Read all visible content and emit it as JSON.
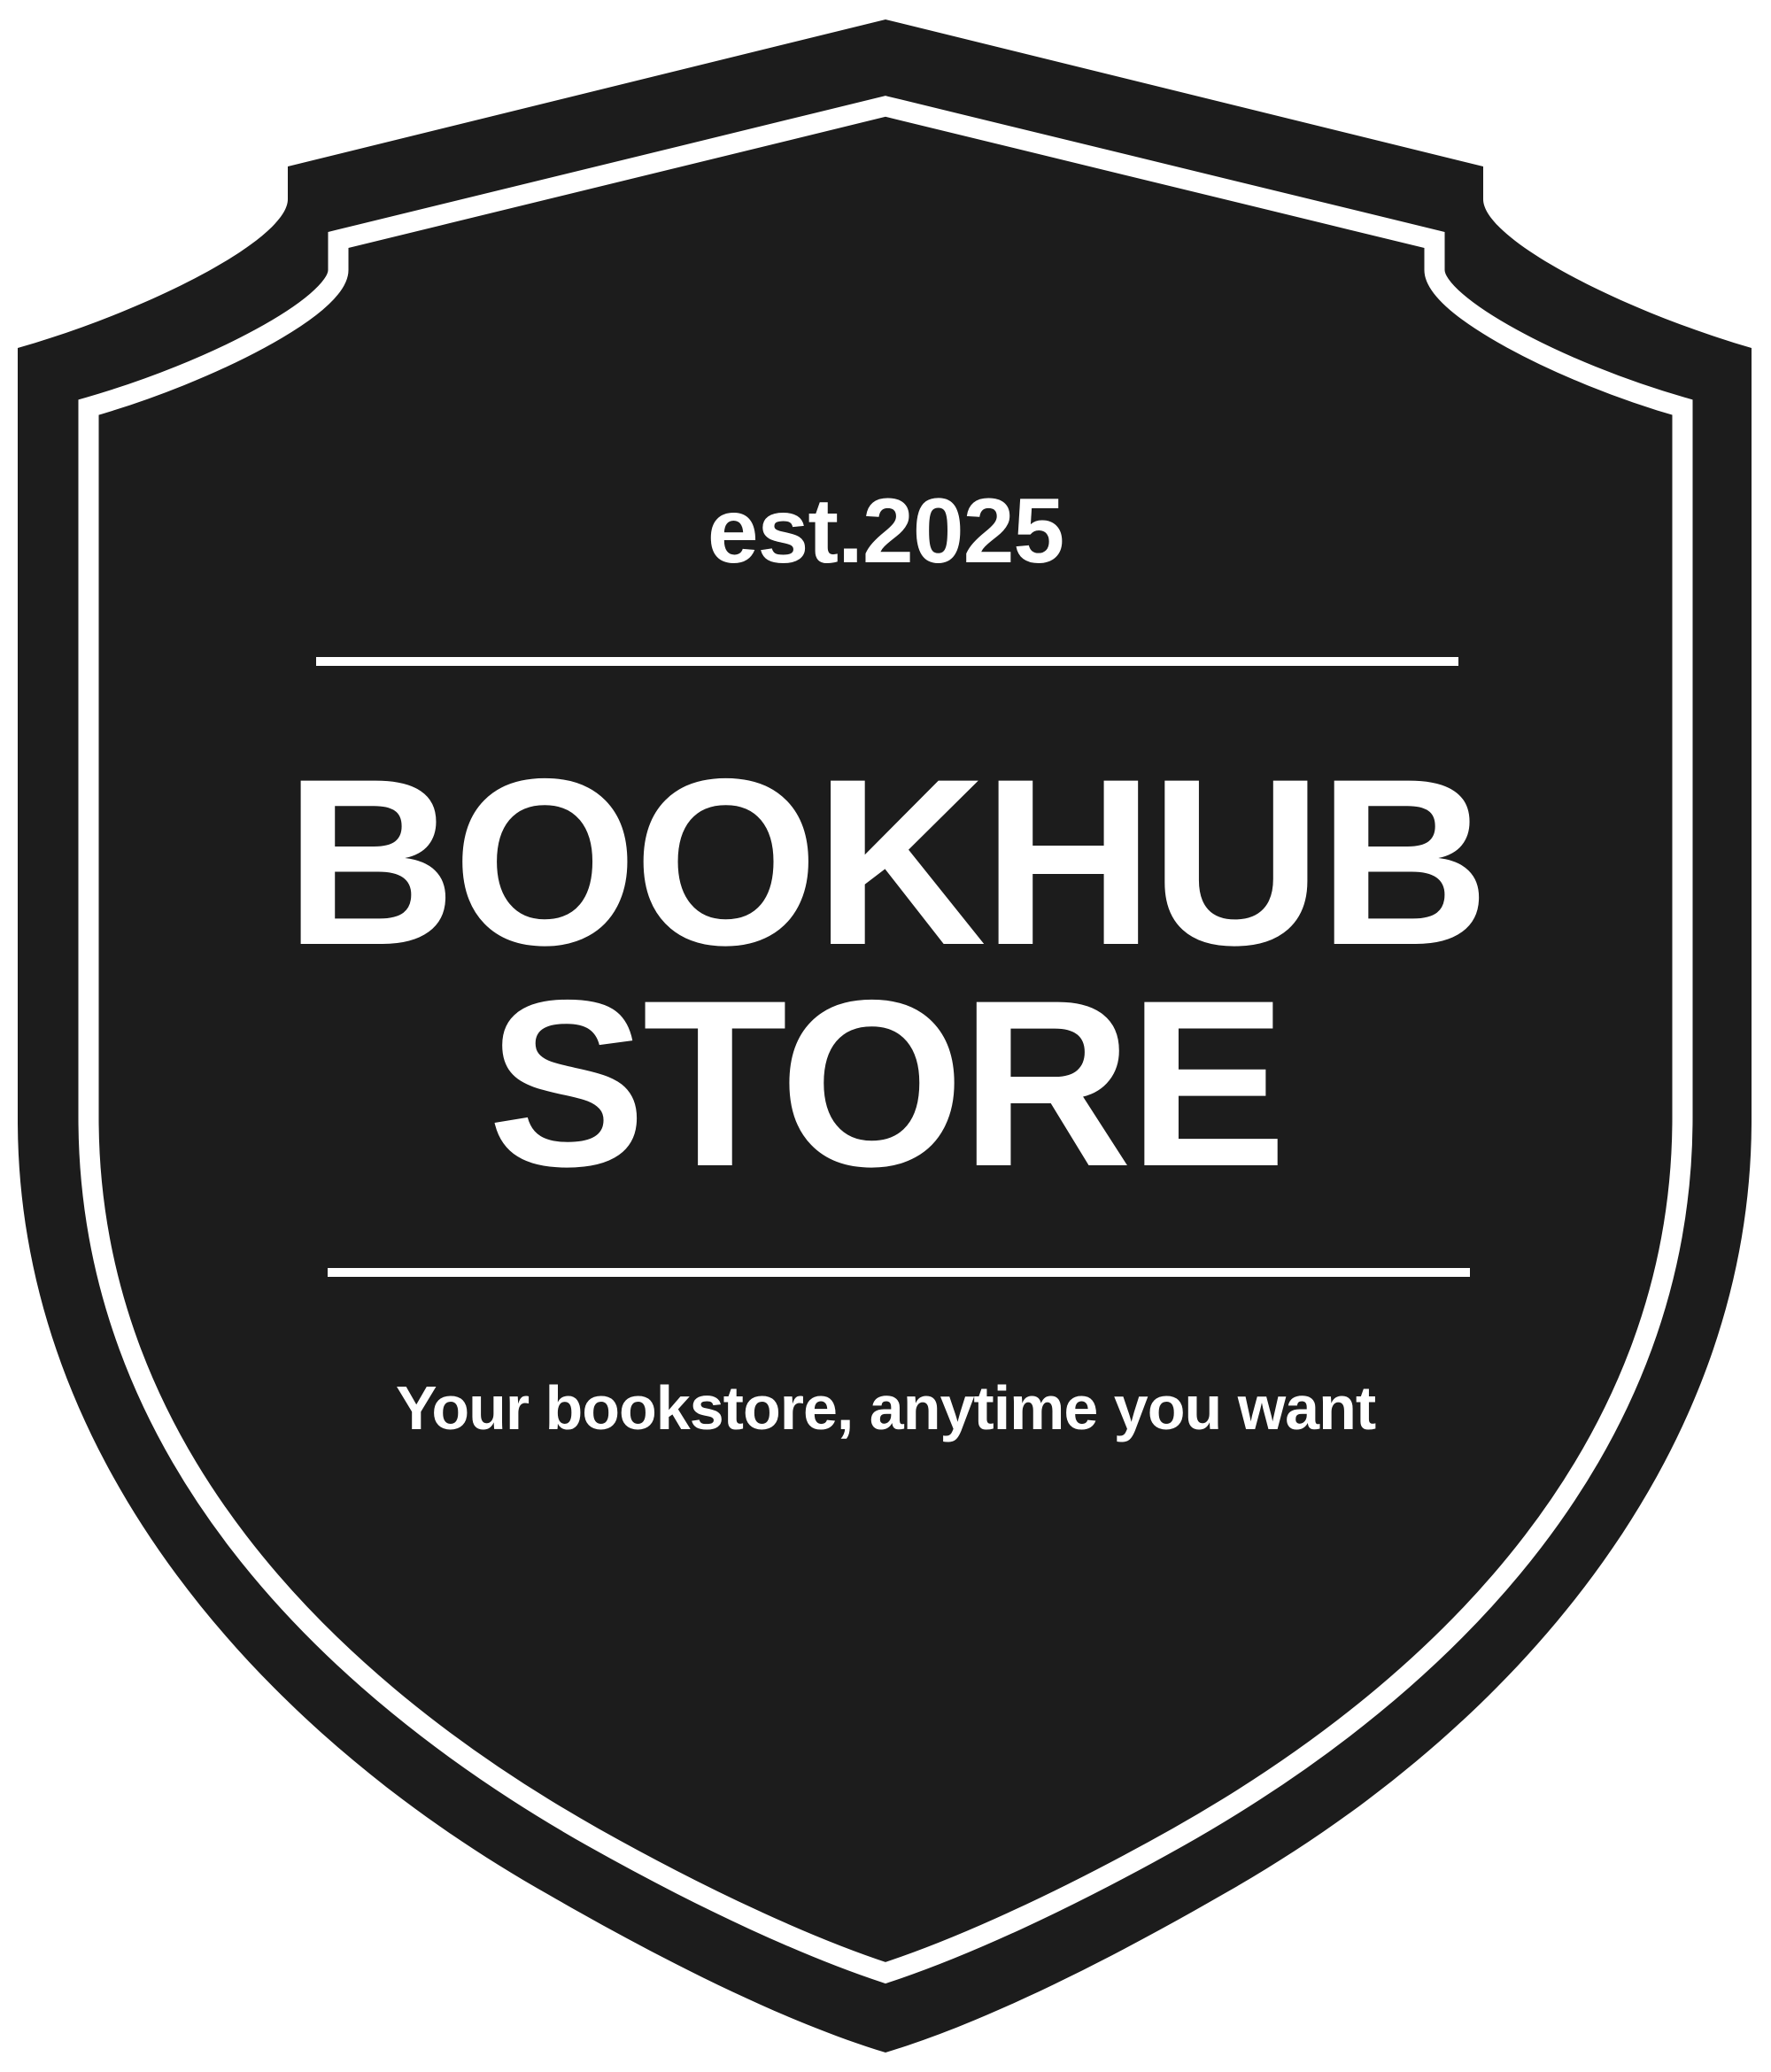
{
  "logo": {
    "established": "est.2025",
    "title_line_1": "BOOKHUB",
    "title_line_2": "STORE",
    "tagline": "Your bookstore, anytime you want"
  },
  "colors": {
    "shield_fill": "#1c1c1c",
    "outline": "#ffffff",
    "text": "#ffffff",
    "background": "#ffffff"
  }
}
